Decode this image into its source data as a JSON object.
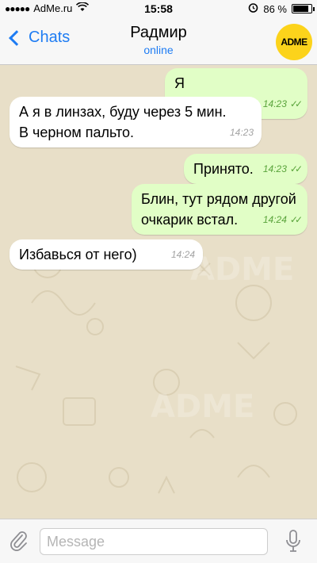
{
  "status_bar": {
    "carrier": "AdMe.ru",
    "time": "15:58",
    "battery": "86 %",
    "battery_level": 0.86
  },
  "header": {
    "back_label": "Chats",
    "contact_name": "Радмир",
    "contact_status": "online",
    "avatar_text": "ADME"
  },
  "messages": [
    {
      "direction": "out",
      "text": "Я очкарик.",
      "time": "14:23"
    },
    {
      "direction": "in",
      "text": "А я в линзах, буду через 5 мин.\nВ черном пальто.",
      "time": "14:23"
    },
    {
      "direction": "out",
      "text": "Принято.",
      "time": "14:23"
    },
    {
      "direction": "out",
      "text": "Блин, тут рядом другой\nочкарик встал.",
      "time": "14:24"
    },
    {
      "direction": "in",
      "text": "Избавься от него)",
      "time": "14:24"
    }
  ],
  "watermark": "ADME",
  "input": {
    "placeholder": "Message"
  },
  "colors": {
    "accent": "#1e7cf3",
    "outgoing_bubble": "#e1fec6",
    "incoming_bubble": "#ffffff",
    "chat_background": "#e8dfc8",
    "avatar": "#fcd31b"
  }
}
